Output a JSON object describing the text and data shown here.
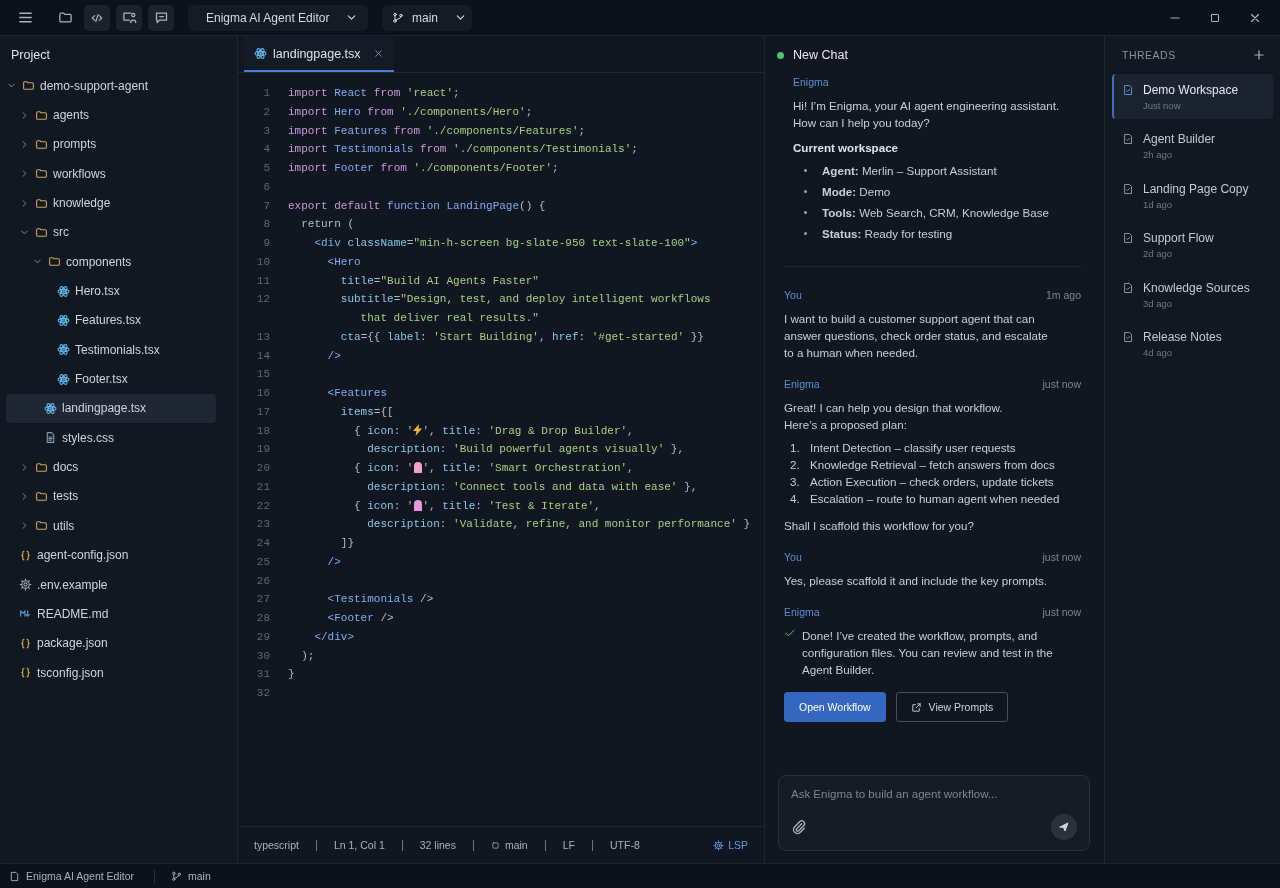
{
  "toolbar": {
    "project": "Enigma AI Agent Editor",
    "branch": "main"
  },
  "explorer": {
    "title": "Project",
    "tree": [
      {
        "name": "demo-support-agent",
        "kind": "folder",
        "expanded": true,
        "selected": false,
        "children": [
          {
            "name": "agents",
            "kind": "folder",
            "expanded": false,
            "selected": false
          },
          {
            "name": "prompts",
            "kind": "folder",
            "expanded": false,
            "selected": false
          },
          {
            "name": "workflows",
            "kind": "folder",
            "expanded": false,
            "selected": false
          },
          {
            "name": "knowledge",
            "kind": "folder",
            "expanded": false,
            "selected": false
          },
          {
            "name": "src",
            "kind": "folder",
            "expanded": true,
            "selected": false,
            "children": [
              {
                "name": "components",
                "kind": "folder",
                "expanded": true,
                "selected": false,
                "children": [
                  {
                    "name": "Hero.tsx",
                    "kind": "react",
                    "selected": false
                  },
                  {
                    "name": "Features.tsx",
                    "kind": "react",
                    "selected": false
                  },
                  {
                    "name": "Testimonials.tsx",
                    "kind": "react",
                    "selected": false
                  },
                  {
                    "name": "Footer.tsx",
                    "kind": "react",
                    "selected": false
                  }
                ]
              },
              {
                "name": "landingpage.tsx",
                "kind": "react",
                "selected": true
              },
              {
                "name": "styles.css",
                "kind": "css",
                "selected": false
              }
            ]
          },
          {
            "name": "docs",
            "kind": "folder",
            "expanded": false,
            "selected": false
          },
          {
            "name": "tests",
            "kind": "folder",
            "expanded": false,
            "selected": false
          },
          {
            "name": "utils",
            "kind": "folder",
            "expanded": false,
            "selected": false
          },
          {
            "name": "agent-config.json",
            "kind": "json",
            "selected": false
          },
          {
            "name": ".env.example",
            "kind": "gear",
            "selected": false
          },
          {
            "name": "README.md",
            "kind": "md",
            "selected": false
          },
          {
            "name": "package.json",
            "kind": "json",
            "selected": false
          },
          {
            "name": "tsconfig.json",
            "kind": "json",
            "selected": false
          }
        ]
      }
    ]
  },
  "editor": {
    "tab": "landingpage.tsx",
    "lines": [
      {
        "n": "1",
        "tokens": [
          {
            "kind": "kw",
            "text": "import "
          },
          {
            "kind": "id",
            "text": "React "
          },
          {
            "kind": "kw",
            "text": "from "
          },
          {
            "kind": "str",
            "text": "'react'"
          },
          {
            "kind": "p",
            "text": ";"
          }
        ]
      },
      {
        "n": "2",
        "tokens": [
          {
            "kind": "kw",
            "text": "import "
          },
          {
            "kind": "id",
            "text": "Hero "
          },
          {
            "kind": "kw",
            "text": "from "
          },
          {
            "kind": "str",
            "text": "'./components/Hero'"
          },
          {
            "kind": "p",
            "text": ";"
          }
        ]
      },
      {
        "n": "3",
        "tokens": [
          {
            "kind": "kw",
            "text": "import "
          },
          {
            "kind": "id",
            "text": "Features "
          },
          {
            "kind": "kw",
            "text": "from "
          },
          {
            "kind": "str",
            "text": "'./components/Features'"
          },
          {
            "kind": "p",
            "text": ";"
          }
        ]
      },
      {
        "n": "4",
        "tokens": [
          {
            "kind": "kw",
            "text": "import "
          },
          {
            "kind": "id",
            "text": "Testimonials "
          },
          {
            "kind": "kw",
            "text": "from "
          },
          {
            "kind": "str",
            "text": "'./components/Testimonials'"
          },
          {
            "kind": "p",
            "text": ";"
          }
        ]
      },
      {
        "n": "5",
        "tokens": [
          {
            "kind": "kw",
            "text": "import "
          },
          {
            "kind": "id",
            "text": "Footer "
          },
          {
            "kind": "kw",
            "text": "from "
          },
          {
            "kind": "str",
            "text": "'./components/Footer'"
          },
          {
            "kind": "p",
            "text": ";"
          }
        ]
      },
      {
        "n": "6"
      },
      {
        "n": "7",
        "tokens": [
          {
            "kind": "kw",
            "text": "export default "
          },
          {
            "kind": "id",
            "text": "function LandingPage"
          },
          {
            "kind": "p",
            "text": "() {"
          }
        ]
      },
      {
        "n": "8",
        "tokens": [
          {
            "kind": "p",
            "text": "  return ("
          }
        ]
      },
      {
        "n": "9",
        "tokens": [
          {
            "kind": "tag",
            "text": "    <div "
          },
          {
            "kind": "attr",
            "text": "className"
          },
          {
            "kind": "p",
            "text": "="
          },
          {
            "kind": "str",
            "text": "\"min-h-screen bg-slate-950 text-slate-100\""
          },
          {
            "kind": "tag",
            "text": ">"
          }
        ]
      },
      {
        "n": "10",
        "tokens": [
          {
            "kind": "tag",
            "text": "      <Hero"
          }
        ]
      },
      {
        "n": "11",
        "tokens": [
          {
            "kind": "attr",
            "text": "        title"
          },
          {
            "kind": "p",
            "text": "="
          },
          {
            "kind": "str",
            "text": "\"Build AI Agents Faster\""
          }
        ]
      },
      {
        "n": "12",
        "tokens": [
          {
            "kind": "attr",
            "text": "        subtitle"
          },
          {
            "kind": "p",
            "text": "="
          },
          {
            "kind": "str",
            "text": "\"Design, test, and deploy intelligent workflows"
          }
        ]
      },
      {
        "tokens": [
          {
            "kind": "str",
            "text": "           that deliver real results.\""
          }
        ]
      },
      {
        "n": "13",
        "tokens": [
          {
            "kind": "attr",
            "text": "        cta"
          },
          {
            "kind": "p",
            "text": "={{ "
          },
          {
            "kind": "attr",
            "text": "label"
          },
          {
            "kind": "p",
            "text": ": "
          },
          {
            "kind": "str",
            "text": "'Start Building'"
          },
          {
            "kind": "p",
            "text": ", "
          },
          {
            "kind": "attr",
            "text": "href"
          },
          {
            "kind": "p",
            "text": ": "
          },
          {
            "kind": "str",
            "text": "'#get-started'"
          },
          {
            "kind": "p",
            "text": " }}"
          }
        ]
      },
      {
        "n": "14",
        "tokens": [
          {
            "kind": "tag",
            "text": "      />"
          }
        ]
      },
      {
        "n": "15"
      },
      {
        "n": "16",
        "tokens": [
          {
            "kind": "tag",
            "text": "      <Features"
          }
        ]
      },
      {
        "n": "17",
        "tokens": [
          {
            "kind": "attr",
            "text": "        items"
          },
          {
            "kind": "p",
            "text": "={["
          }
        ]
      },
      {
        "n": "18",
        "tokens": [
          {
            "kind": "p",
            "text": "          { "
          },
          {
            "kind": "attr",
            "text": "icon"
          },
          {
            "kind": "p",
            "text": ": '"
          },
          {
            "kind": "bolt",
            "color": "#f5b82e"
          },
          {
            "kind": "p",
            "text": "', "
          },
          {
            "kind": "attr",
            "text": "title"
          },
          {
            "kind": "p",
            "text": ": "
          },
          {
            "kind": "str",
            "text": "'Drag & Drop Builder'"
          },
          {
            "kind": "p",
            "text": ","
          }
        ]
      },
      {
        "n": "19",
        "tokens": [
          {
            "kind": "attr",
            "text": "            description"
          },
          {
            "kind": "p",
            "text": ": "
          },
          {
            "kind": "str",
            "text": "'Build powerful agents visually'"
          },
          {
            "kind": "p",
            "text": " },"
          }
        ]
      },
      {
        "n": "20",
        "tokens": [
          {
            "kind": "p",
            "text": "          { "
          },
          {
            "kind": "attr",
            "text": "icon"
          },
          {
            "kind": "p",
            "text": ": '"
          },
          {
            "kind": "blob",
            "color": "#f0a3c4"
          },
          {
            "kind": "p",
            "text": "', "
          },
          {
            "kind": "attr",
            "text": "title"
          },
          {
            "kind": "p",
            "text": ": "
          },
          {
            "kind": "str",
            "text": "'Smart Orchestration'"
          },
          {
            "kind": "p",
            "text": ","
          }
        ]
      },
      {
        "n": "21",
        "tokens": [
          {
            "kind": "attr",
            "text": "            description"
          },
          {
            "kind": "p",
            "text": ": "
          },
          {
            "kind": "str",
            "text": "'Connect tools and data with ease'"
          },
          {
            "kind": "p",
            "text": " },"
          }
        ]
      },
      {
        "n": "22",
        "tokens": [
          {
            "kind": "p",
            "text": "          { "
          },
          {
            "kind": "attr",
            "text": "icon"
          },
          {
            "kind": "p",
            "text": ": '"
          },
          {
            "kind": "blob",
            "color": "#e59ad8"
          },
          {
            "kind": "p",
            "text": "', "
          },
          {
            "kind": "attr",
            "text": "title"
          },
          {
            "kind": "p",
            "text": ": "
          },
          {
            "kind": "str",
            "text": "'Test & Iterate'"
          },
          {
            "kind": "p",
            "text": ","
          }
        ]
      },
      {
        "n": "23",
        "tokens": [
          {
            "kind": "attr",
            "text": "            description"
          },
          {
            "kind": "p",
            "text": ": "
          },
          {
            "kind": "str",
            "text": "'Validate, refine, and monitor performance'"
          },
          {
            "kind": "p",
            "text": " }"
          }
        ]
      },
      {
        "n": "24",
        "tokens": [
          {
            "kind": "p",
            "text": "        ]}"
          }
        ]
      },
      {
        "n": "25",
        "tokens": [
          {
            "kind": "tag",
            "text": "      />"
          }
        ]
      },
      {
        "n": "26"
      },
      {
        "n": "27",
        "tokens": [
          {
            "kind": "tag",
            "text": "      <Testimonials "
          },
          {
            "kind": "p",
            "text": "/>"
          }
        ]
      },
      {
        "n": "28",
        "tokens": [
          {
            "kind": "tag",
            "text": "      <Footer "
          },
          {
            "kind": "p",
            "text": "/>"
          }
        ]
      },
      {
        "n": "29",
        "tokens": [
          {
            "kind": "tag",
            "text": "    </div>"
          }
        ]
      },
      {
        "n": "30",
        "tokens": [
          {
            "kind": "p",
            "text": "  );"
          }
        ]
      },
      {
        "n": "31",
        "tokens": [
          {
            "kind": "p",
            "text": "}"
          }
        ]
      },
      {
        "n": "32"
      }
    ],
    "status": {
      "language": "typescript",
      "cursor": "Ln 1, Col 1",
      "line_count": "32 lines",
      "branch": "main",
      "eol": "LF",
      "encoding": "UTF-8",
      "lsp": "LSP"
    }
  },
  "chat": {
    "title": "New Chat",
    "messages": [
      {
        "author": "Enigma",
        "blocks": [
          {
            "kind": "p",
            "text": "Hi! I’m Enigma, your AI agent engineering assistant.\nHow can I help you today?"
          },
          {
            "kind": "h",
            "text": "Current workspace"
          },
          {
            "kind": "ul",
            "items": [
              "**Agent:** Merlin – Support Assistant",
              "**Mode:** Demo",
              "**Tools:** Web Search, CRM, Knowledge Base",
              "**Status:** Ready for testing"
            ]
          }
        ]
      },
      {
        "author": "You",
        "time": "1m ago",
        "blocks": [
          {
            "kind": "p",
            "text": "I want to build a customer support agent that can\nanswer questions, check order status, and escalate\nto a human when needed."
          }
        ]
      },
      {
        "author": "Enigma",
        "time": "just now",
        "blocks": [
          {
            "kind": "p",
            "text": "Great! I can help you design that workflow.\nHere’s a proposed plan:"
          },
          {
            "kind": "ol",
            "items": [
              {
                "n": "1.",
                "text": "Intent Detection – classify user requests"
              },
              {
                "n": "2.",
                "text": "Knowledge Retrieval – fetch answers from docs"
              },
              {
                "n": "3.",
                "text": "Action Execution – check orders, update tickets"
              },
              {
                "n": "4.",
                "text": "Escalation – route to human agent when needed"
              }
            ]
          },
          {
            "kind": "p",
            "text": "Shall I scaffold this workflow for you?"
          }
        ]
      },
      {
        "author": "You",
        "time": "just now",
        "blocks": [
          {
            "kind": "p",
            "text": "Yes, please scaffold it and include the key prompts."
          }
        ]
      },
      {
        "author": "Enigma",
        "time": "just now",
        "blocks": [
          {
            "kind": "done",
            "text": "Done! I’ve created the workflow, prompts, and\nconfiguration files. You can review and test in the\nAgent Builder."
          },
          {
            "kind": "actions",
            "buttons": [
              {
                "label": "Open Workflow",
                "primary": true
              },
              {
                "label": "View Prompts",
                "primary": false
              }
            ]
          }
        ]
      }
    ],
    "input": {
      "placeholder": "Ask Enigma to build an agent workflow..."
    }
  },
  "threads": {
    "title": "THREADS",
    "items": [
      {
        "title": "Demo Workspace",
        "time": "Just now",
        "selected": true
      },
      {
        "title": "Agent Builder",
        "time": "2h ago",
        "selected": false
      },
      {
        "title": "Landing Page Copy",
        "time": "1d ago",
        "selected": false
      },
      {
        "title": "Support Flow",
        "time": "2d ago",
        "selected": false
      },
      {
        "title": "Knowledge Sources",
        "time": "3d ago",
        "selected": false
      },
      {
        "title": "Release Notes",
        "time": "4d ago",
        "selected": false
      }
    ]
  },
  "status_bar": {
    "project": "Enigma AI Agent Editor",
    "branch": "main"
  }
}
